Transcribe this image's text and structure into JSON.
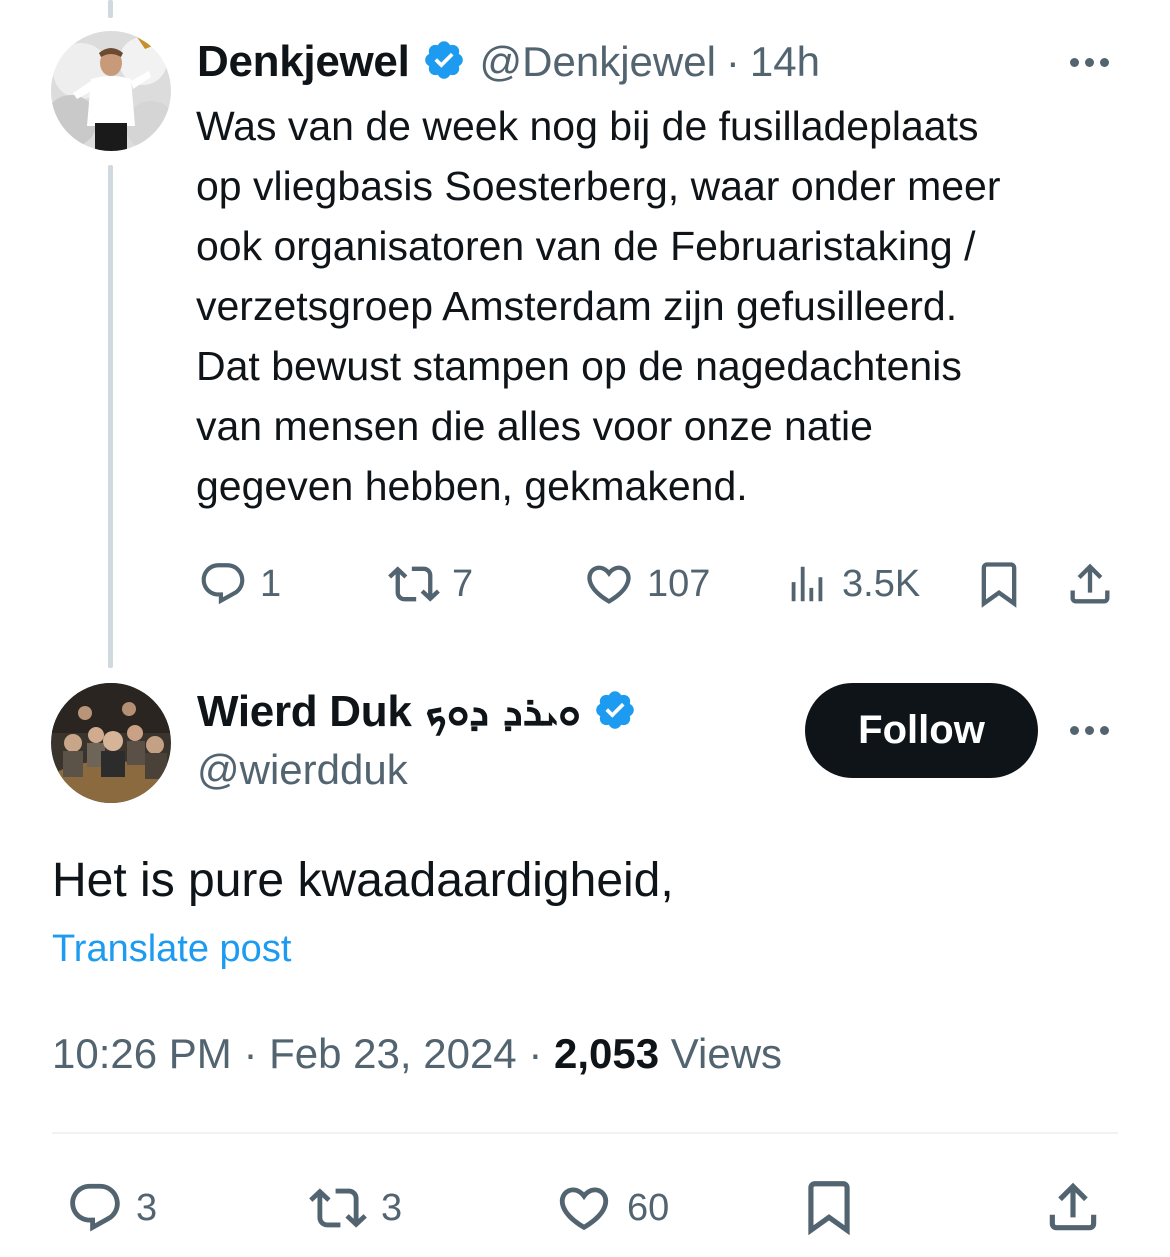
{
  "quoted_tweet": {
    "author_name": "Denkjewel",
    "handle": "@Denkjewel",
    "separator": "·",
    "time": "14h",
    "text_lines": [
      "Was van de week nog bij de fusilladeplaats",
      "op vliegbasis Soesterberg, waar onder meer",
      "ook organisatoren van de Februaristaking /",
      "verzetsgroep Amsterdam zijn gefusilleerd.",
      "Dat bewust stampen op de nagedachtenis",
      "van mensen die alles voor onze natie",
      "gegeven hebben, gekmakend."
    ],
    "stats": {
      "replies": "1",
      "retweets": "7",
      "likes": "107",
      "views": "3.5K"
    }
  },
  "main_tweet": {
    "author_name": "Wierd Duk",
    "name_script": "ܘܝܪܕ ܕܘܟ",
    "handle": "@wierdduk",
    "follow_label": "Follow",
    "text": "Het is pure kwaadaardigheid,",
    "translate_label": "Translate post",
    "time": "10:26 PM",
    "date": "Feb 23, 2024",
    "sep1": "·",
    "sep2": "·",
    "views_count": "2,053",
    "views_label": "Views",
    "stats": {
      "replies": "3",
      "retweets": "3",
      "likes": "60"
    }
  },
  "colors": {
    "accent": "#1d9bf0",
    "text": "#0f1419",
    "secondary": "#536471",
    "thread_line": "#cfd9de"
  },
  "icons": [
    "reply-icon",
    "retweet-icon",
    "like-icon",
    "views-icon",
    "bookmark-icon",
    "share-icon",
    "verified-icon",
    "more-icon"
  ]
}
